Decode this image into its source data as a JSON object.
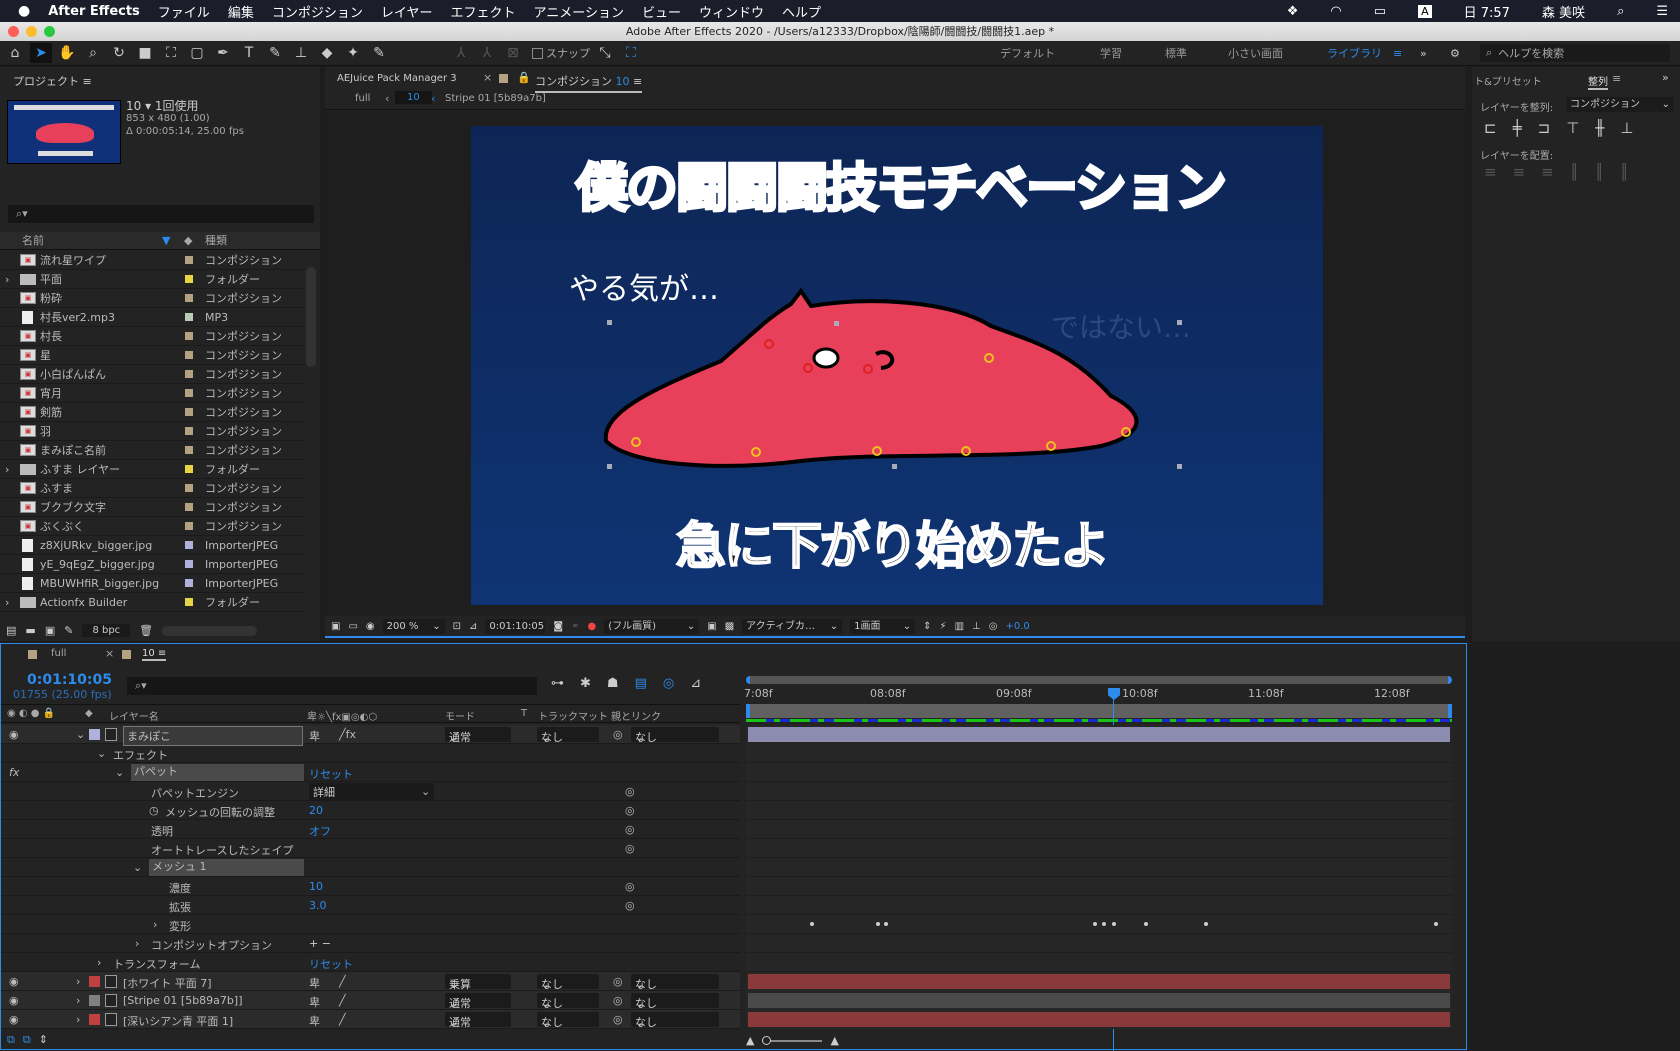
{
  "menubar": {
    "app": "After Effects",
    "items": [
      "ファイル",
      "編集",
      "コンポジション",
      "レイヤー",
      "エフェクト",
      "アニメーション",
      "ビュー",
      "ウィンドウ",
      "ヘルプ"
    ],
    "clock": "日 7:57",
    "user": "森 美咲",
    "input_mode": "A"
  },
  "window": {
    "title": "Adobe After Effects 2020 - /Users/a12333/Dropbox/陰陽師/闘闘技/闘闘技1.aep *"
  },
  "toolbar": {
    "snap": "スナップ",
    "workspaces": [
      "デフォルト",
      "学習",
      "標準",
      "小さい画面",
      "ライブラリ"
    ],
    "active_workspace": "ライブラリ",
    "help_placeholder": "ヘルプを検索"
  },
  "project": {
    "title": "プロジェクト",
    "comp_name": "10 ▾ 1回使用",
    "dims": "853 x 480 (1.00)",
    "duration": "Δ 0:00:05:14, 25.00 fps",
    "col_name": "名前",
    "col_type": "種類",
    "items": [
      {
        "name": "流れ星ワイプ",
        "type": "コンポジション",
        "color": "#b5a283",
        "kind": "comp"
      },
      {
        "name": "平面",
        "type": "フォルダー",
        "color": "#e6d444",
        "kind": "folder"
      },
      {
        "name": "粉砕",
        "type": "コンポジション",
        "color": "#b5a283",
        "kind": "comp"
      },
      {
        "name": "村長ver2.mp3",
        "type": "MP3",
        "color": "#b5cdb5",
        "kind": "file"
      },
      {
        "name": "村長",
        "type": "コンポジション",
        "color": "#b5a283",
        "kind": "comp"
      },
      {
        "name": "星",
        "type": "コンポジション",
        "color": "#b5a283",
        "kind": "comp"
      },
      {
        "name": "小白ぱんぱん",
        "type": "コンポジション",
        "color": "#b5a283",
        "kind": "comp"
      },
      {
        "name": "宵月",
        "type": "コンポジション",
        "color": "#b5a283",
        "kind": "comp"
      },
      {
        "name": "剣筋",
        "type": "コンポジション",
        "color": "#b5a283",
        "kind": "comp"
      },
      {
        "name": "羽",
        "type": "コンポジション",
        "color": "#b5a283",
        "kind": "comp"
      },
      {
        "name": "まみぽこ名前",
        "type": "コンポジション",
        "color": "#b5a283",
        "kind": "comp"
      },
      {
        "name": "ふすま レイヤー",
        "type": "フォルダー",
        "color": "#e6d444",
        "kind": "folder"
      },
      {
        "name": "ふすま",
        "type": "コンポジション",
        "color": "#b5a283",
        "kind": "comp"
      },
      {
        "name": "ブクブク文字",
        "type": "コンポジション",
        "color": "#b5a283",
        "kind": "comp"
      },
      {
        "name": "ぶくぶく",
        "type": "コンポジション",
        "color": "#b5a283",
        "kind": "comp"
      },
      {
        "name": "z8XjURkv_bigger.jpg",
        "type": "ImporterJPEG",
        "color": "#b0b0dc",
        "kind": "file"
      },
      {
        "name": "yE_9qEgZ_bigger.jpg",
        "type": "ImporterJPEG",
        "color": "#b0b0dc",
        "kind": "file"
      },
      {
        "name": "MBUWHfiR_bigger.jpg",
        "type": "ImporterJPEG",
        "color": "#b0b0dc",
        "kind": "file"
      },
      {
        "name": "Actionfx Builder",
        "type": "フォルダー",
        "color": "#e6d444",
        "kind": "folder"
      }
    ],
    "bpc": "8 bpc"
  },
  "viewer": {
    "tabs": [
      "AEJuice Pack Manager 3",
      "コンポジション"
    ],
    "comp_tab_num": "10",
    "breadcrumb": [
      "full",
      "10",
      "Stripe 01 [5b89a7b]"
    ],
    "comp_text": {
      "title": "僕の闘闘闘技モチベーション",
      "line1": "やる気が…",
      "line2": "ではない…",
      "line3": "急に下がり始めたよ"
    },
    "zoom": "200 %",
    "timecode": "0:01:10:05",
    "quality": "(フル画質)",
    "camera": "アクティブカ…",
    "views": "1画面",
    "exposure": "+0.0"
  },
  "right_panel": {
    "tabs": [
      "ト&プリセット",
      "整列"
    ],
    "align_to_label": "レイヤーを整列:",
    "align_to_value": "コンポジション",
    "distribute_label": "レイヤーを配置:"
  },
  "timeline": {
    "tabs": [
      "full",
      "10"
    ],
    "timecode": "0:01:10:05",
    "frames": "01755 (25.00 fps)",
    "headers": {
      "layer_name": "レイヤー名",
      "mode": "モード",
      "t": "T",
      "trackmatte": "トラックマット",
      "parent": "親とリンク"
    },
    "ruler": [
      "7:08f",
      "08:08f",
      "09:08f",
      "10:08f",
      "11:08f",
      "12:08f"
    ],
    "layers": [
      {
        "name": "まみぽこ",
        "mode": "通常",
        "matte": "なし",
        "parent": "なし",
        "label": "#b0b0dc"
      },
      {
        "name": "[ホワイト 平面 7]",
        "mode": "乗算",
        "matte": "なし",
        "parent": "なし",
        "label": "#c04040"
      },
      {
        "name": "[Stripe 01 [5b89a7b]]",
        "mode": "通常",
        "matte": "なし",
        "parent": "なし",
        "label": "#808080"
      },
      {
        "name": "[深いシアン青 平面 1]",
        "mode": "通常",
        "matte": "なし",
        "parent": "なし",
        "label": "#c04040"
      }
    ],
    "props": {
      "effects": "エフェクト",
      "puppet": "パペット",
      "reset": "リセット",
      "engine": "パペットエンジン",
      "engine_val": "詳細",
      "mesh_rot": "メッシュの回転の調整",
      "mesh_rot_val": "20",
      "transparent": "透明",
      "transparent_val": "オフ",
      "autotrace": "オートトレースしたシェイプ",
      "mesh": "メッシュ 1",
      "density": "濃度",
      "density_val": "10",
      "expansion": "拡張",
      "expansion_val": "3.0",
      "deform": "変形",
      "composite": "コンポジットオプション",
      "plusminus": "+ −",
      "transform": "トランスフォーム"
    }
  },
  "colors": {
    "accent": "#2d8ceb",
    "comp_bg": "#0d2a5e",
    "blob": "#e8405a"
  }
}
